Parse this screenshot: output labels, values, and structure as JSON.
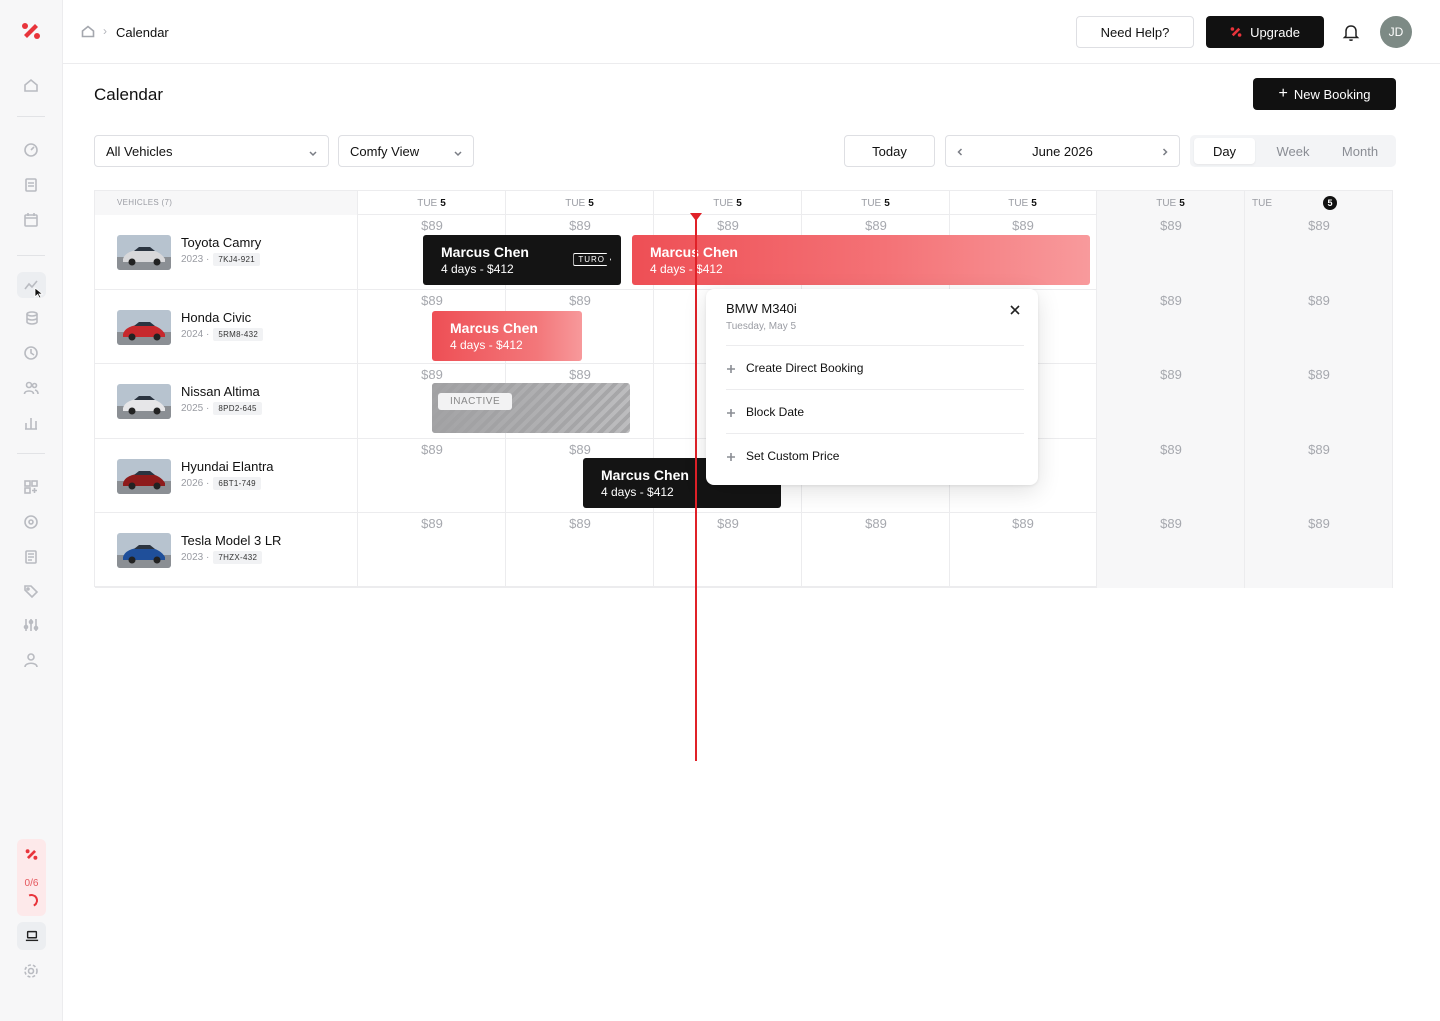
{
  "topbar": {
    "breadcrumb": "Calendar",
    "help_label": "Need Help?",
    "upgrade_label": "Upgrade",
    "avatar_initials": "JD"
  },
  "page": {
    "title": "Calendar",
    "new_booking_label": "New Booking"
  },
  "filters": {
    "vehicles_select": "All Vehicles",
    "view_select": "Comfy View",
    "today_label": "Today",
    "month_label": "June 2026",
    "view_modes": [
      "Day",
      "Week",
      "Month"
    ],
    "active_view": "Day"
  },
  "sidebar": {
    "usage_count": "0/6"
  },
  "grid": {
    "vehicles_header": "VEHICLES (7)",
    "days": [
      {
        "dow": "TUE",
        "num": "5",
        "weekend": false
      },
      {
        "dow": "TUE",
        "num": "5",
        "weekend": false
      },
      {
        "dow": "TUE",
        "num": "5",
        "weekend": false
      },
      {
        "dow": "TUE",
        "num": "5",
        "weekend": false
      },
      {
        "dow": "TUE",
        "num": "5",
        "weekend": false
      },
      {
        "dow": "TUE",
        "num": "5",
        "weekend": true
      },
      {
        "dow": "TUE",
        "num": "5",
        "weekend": true,
        "today": true
      }
    ],
    "price": "$89",
    "vehicles": [
      {
        "name": "Toyota Camry",
        "year": "2023 ·",
        "plate": "7KJ4-921"
      },
      {
        "name": "Honda Civic",
        "year": "2024 ·",
        "plate": "5RM8-432"
      },
      {
        "name": "Nissan Altima",
        "year": "2025 ·",
        "plate": "8PD2-645"
      },
      {
        "name": "Hyundai Elantra",
        "year": "2026 ·",
        "plate": "6BT1-749"
      },
      {
        "name": "Tesla Model 3 LR",
        "year": "2023 ·",
        "plate": "7HZX-432"
      }
    ]
  },
  "bookings": [
    {
      "guest": "Marcus Chen",
      "detail": "4 days - $412",
      "source": "TURO"
    },
    {
      "guest": "Marcus Chen",
      "detail": "4 days - $412"
    },
    {
      "guest": "Marcus Chen",
      "detail": "4 days - $412"
    },
    {
      "guest": "Marcus Chen",
      "detail": "4 days - $412"
    }
  ],
  "inactive_label": "INACTIVE",
  "popover": {
    "title": "BMW M340i",
    "date": "Tuesday, May 5",
    "actions": [
      "Create Direct Booking",
      "Block Date",
      "Set Custom Price"
    ]
  },
  "colors": {
    "brand_red": "#e8343b",
    "now_line": "#e02128",
    "dark_booking": "#141414"
  }
}
